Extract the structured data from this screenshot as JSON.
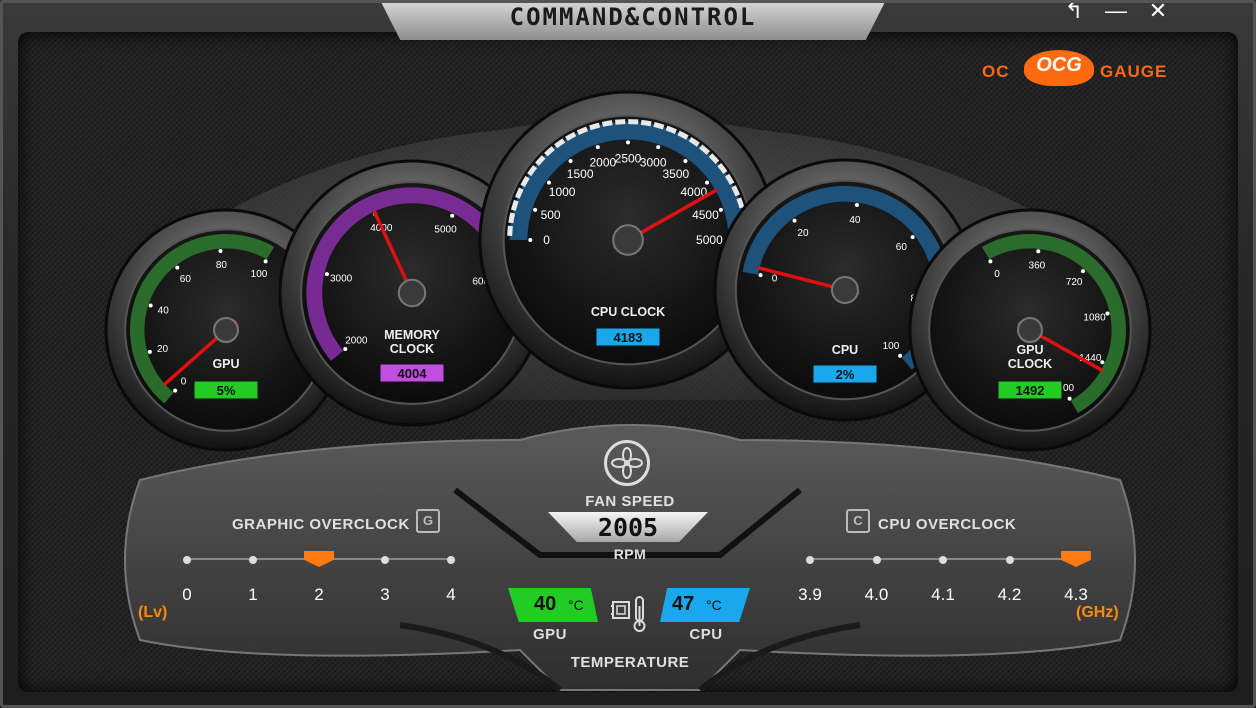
{
  "window": {
    "title": "COMMAND&CONTROL",
    "back_glyph": "↰",
    "minimize_glyph": "—",
    "close_glyph": "✕"
  },
  "logo": {
    "left": "OC",
    "badge": "OCG",
    "right": "GAUGE"
  },
  "gauges": {
    "gpu": {
      "label": "GPU",
      "ticks": [
        "0",
        "20",
        "40",
        "60",
        "80",
        "100"
      ],
      "value_text": "5%",
      "value": 5,
      "range": [
        0,
        100
      ],
      "badge_color": "#22cc22",
      "arc_color": "#2f7a2f"
    },
    "memory": {
      "label_line1": "MEMORY",
      "label_line2": "CLOCK",
      "ticks": [
        "2000",
        "3000",
        "4000",
        "5000",
        "6000"
      ],
      "value_text": "4004",
      "value": 4004,
      "range": [
        2000,
        6000
      ],
      "badge_color": "#c04ee0",
      "arc_color": "#8a2fa8"
    },
    "cpu_clock": {
      "label": "CPU CLOCK",
      "ticks": [
        "0",
        "500",
        "1000",
        "1500",
        "2000",
        "2500",
        "3000",
        "3500",
        "4000",
        "4500",
        "5000"
      ],
      "value_text": "4183",
      "value": 4183,
      "range": [
        0,
        5000
      ],
      "badge_color": "#1aa7ec",
      "arc_color": "#1e5d8e"
    },
    "cpu": {
      "label": "CPU",
      "ticks": [
        "0",
        "20",
        "40",
        "60",
        "80",
        "100"
      ],
      "value_text": "2%",
      "value": 2,
      "range": [
        0,
        100
      ],
      "badge_color": "#1aa7ec",
      "arc_color": "#1e5d8e"
    },
    "gpu_clock": {
      "label_line1": "GPU",
      "label_line2": "CLOCK",
      "ticks": [
        "0",
        "360",
        "720",
        "1080",
        "1440",
        "1800"
      ],
      "value_text": "1492",
      "value": 1492,
      "range": [
        0,
        1800
      ],
      "badge_color": "#22cc22",
      "arc_color": "#2f7a2f"
    }
  },
  "fan": {
    "title": "FAN SPEED",
    "value": "2005",
    "unit": "RPM"
  },
  "temperature": {
    "title": "TEMPERATURE",
    "gpu_value": "40",
    "gpu_unit": "°C",
    "gpu_label": "GPU",
    "cpu_value": "47",
    "cpu_unit": "°C",
    "cpu_label": "CPU",
    "gpu_color": "#22cc22",
    "cpu_color": "#1aa7ec"
  },
  "graphic_overclock": {
    "title": "GRAPHIC OVERCLOCK",
    "levels": [
      "0",
      "1",
      "2",
      "3",
      "4"
    ],
    "selected_index": 2,
    "unit": "(Lv)"
  },
  "cpu_overclock": {
    "title": "CPU OVERCLOCK",
    "levels": [
      "3.9",
      "4.0",
      "4.1",
      "4.2",
      "4.3"
    ],
    "selected_index": 4,
    "unit": "(GHz)"
  },
  "colors": {
    "accent_orange": "#ff7a10"
  }
}
